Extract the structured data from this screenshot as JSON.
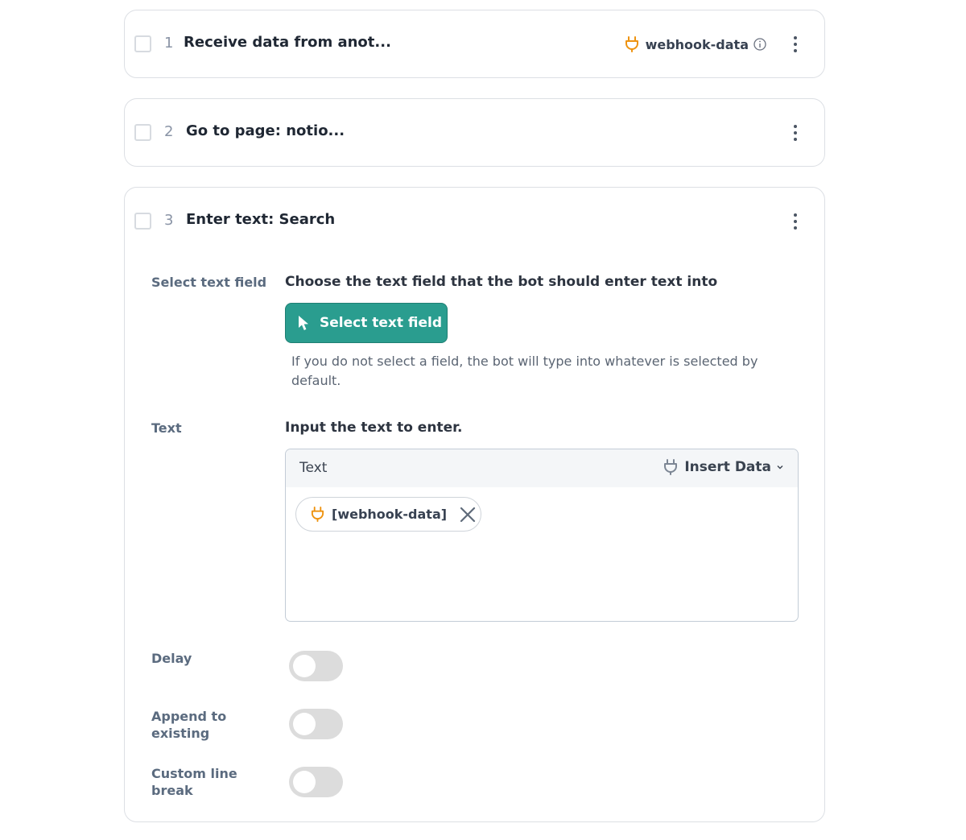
{
  "colors": {
    "accent": "#2a9d8f",
    "plug_orange": "#ee9310",
    "plug_grey": "#7c8694"
  },
  "steps": [
    {
      "number": "1",
      "title": "Receive data from anot...",
      "variable": {
        "icon": "plug-icon",
        "label": "webhook-data",
        "info_icon": "info-icon"
      },
      "menu_icon": "kebab-menu-icon"
    },
    {
      "number": "2",
      "title": "Go to page: notio...",
      "menu_icon": "kebab-menu-icon"
    },
    {
      "number": "3",
      "title": "Enter text: Search",
      "menu_icon": "kebab-menu-icon",
      "fields": {
        "select_text_field": {
          "label": "Select text field",
          "description": "Choose the text field that the bot should enter text into",
          "button_label": "Select text field",
          "button_icon": "cursor-icon",
          "hint": "If you do not select a field, the bot will type into whatever is selected by default."
        },
        "text": {
          "label": "Text",
          "description": "Input the text to enter.",
          "box_title": "Text",
          "insert_data_label": "Insert Data",
          "chip_label": "[webhook-data]"
        },
        "delay": {
          "label": "Delay",
          "enabled": false
        },
        "append": {
          "label": "Append to existing",
          "enabled": false
        },
        "line_break": {
          "label": "Custom line break",
          "enabled": false
        }
      }
    }
  ]
}
